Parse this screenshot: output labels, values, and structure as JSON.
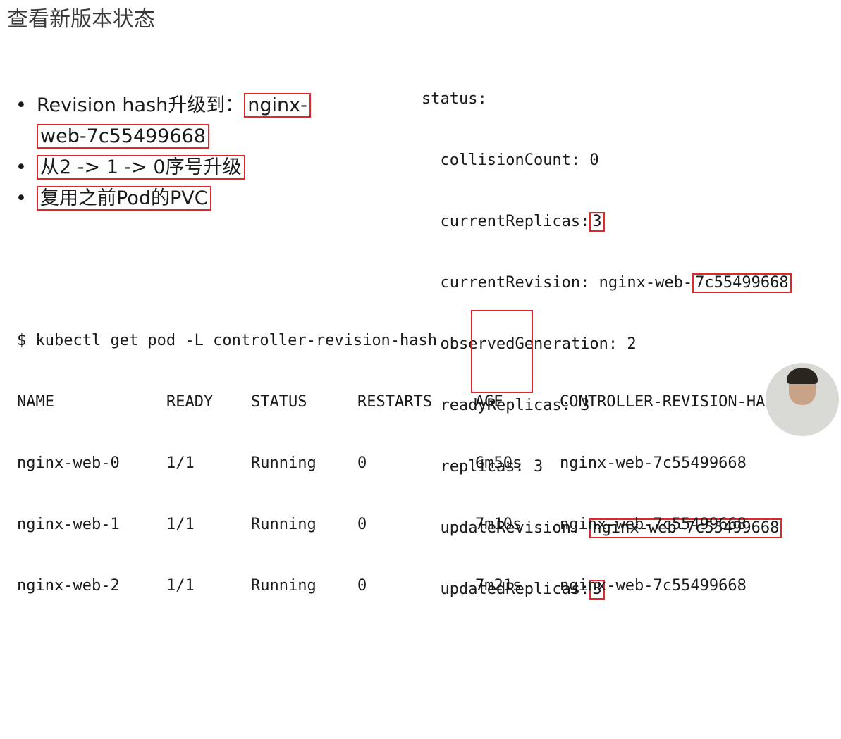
{
  "title": "查看新版本状态",
  "bullets": {
    "b1_prefix": "Revision hash升级到：",
    "b1_hl_a": "nginx-",
    "b1_hl_b": "web-7c55499668",
    "b2": "从2 -> 1 -> 0序号升级",
    "b3": "复用之前Pod的PVC"
  },
  "status": {
    "header": "status:",
    "collision": "  collisionCount: 0",
    "current_replicas_key": "  currentReplicas:",
    "current_replicas_val": "3",
    "current_revision_key": "  currentRevision: nginx-web-",
    "current_revision_val": "7c55499668",
    "observed": "  observedGeneration: 2",
    "ready": "  readyReplicas: 3",
    "replicas": "  replicas: 3",
    "update_revision_key": "  updateRevision:",
    "update_revision_val": "nginx-web-7c55499668",
    "updated_replicas_key": "  updatedReplicas:",
    "updated_replicas_val": "3"
  },
  "command": "$ kubectl get pod -L controller-revision-hash",
  "table": {
    "headers": {
      "name": "NAME",
      "ready": "READY",
      "status": "STATUS",
      "restarts": "RESTARTS",
      "age": "AGE",
      "hash": "CONTROLLER-REVISION-HASH"
    },
    "rows": [
      {
        "name": "nginx-web-0",
        "ready": "1/1",
        "status": "Running",
        "restarts": "0",
        "age": "6m50s",
        "hash": "nginx-web-7c55499668"
      },
      {
        "name": "nginx-web-1",
        "ready": "1/1",
        "status": "Running",
        "restarts": "0",
        "age": "7m10s",
        "hash": "nginx-web-7c55499668"
      },
      {
        "name": "nginx-web-2",
        "ready": "1/1",
        "status": "Running",
        "restarts": "0",
        "age": "7m21s",
        "hash": "nginx-web-7c55499668"
      }
    ]
  },
  "colors": {
    "highlight": "#e3262b",
    "text": "#1a1a1a",
    "title": "#3a3a3a"
  }
}
